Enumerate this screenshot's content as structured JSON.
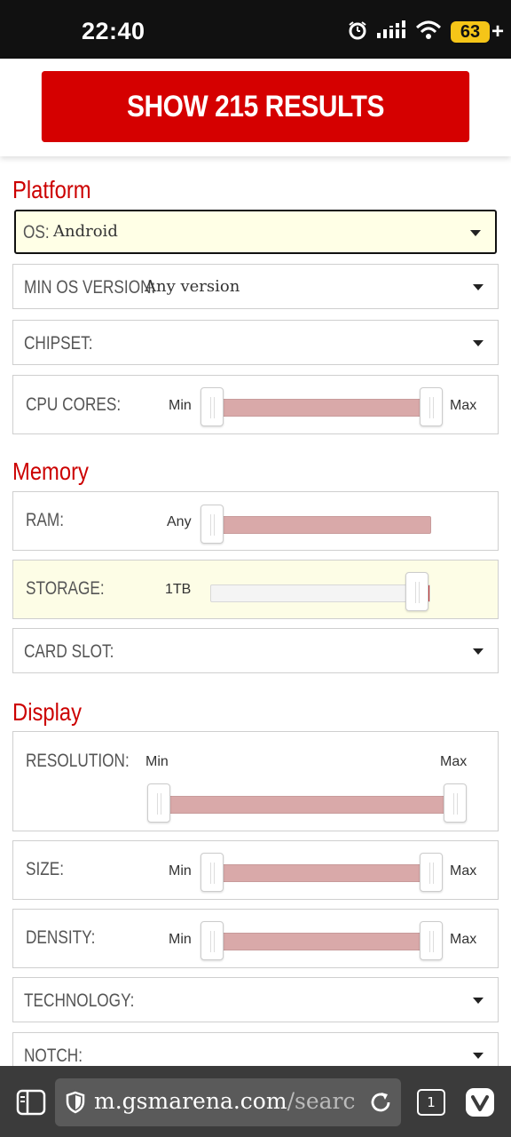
{
  "status_bar": {
    "time": "22:40",
    "battery_level": "63",
    "icons": [
      "alarm-icon",
      "signal-icon",
      "wifi-icon",
      "battery-icon"
    ]
  },
  "header": {
    "show_results_label": "SHOW 215 RESULTS"
  },
  "colors": {
    "accent": "#d50000",
    "section_title": "#cc0000",
    "slider_fill": "#d9a9a9"
  },
  "sections": {
    "platform": {
      "title": "Platform",
      "os": {
        "label": "OS:",
        "value": "Android"
      },
      "min_os_version": {
        "label": "MIN OS VERSION:",
        "value": "Any version"
      },
      "chipset": {
        "label": "CHIPSET:"
      },
      "cpu_cores": {
        "label": "CPU CORES:",
        "min": "Min",
        "max": "Max"
      }
    },
    "memory": {
      "title": "Memory",
      "ram": {
        "label": "RAM:",
        "value": "Any"
      },
      "storage": {
        "label": "STORAGE:",
        "value": "1TB"
      },
      "card_slot": {
        "label": "CARD SLOT:"
      }
    },
    "display": {
      "title": "Display",
      "resolution": {
        "label": "RESOLUTION:",
        "min": "Min",
        "max": "Max"
      },
      "size": {
        "label": "SIZE:",
        "min": "Min",
        "max": "Max"
      },
      "density": {
        "label": "DENSITY:",
        "min": "Min",
        "max": "Max"
      },
      "technology": {
        "label": "TECHNOLOGY:"
      },
      "notch": {
        "label": "NOTCH:"
      }
    }
  },
  "browser": {
    "url_main": "m.gsmarena.com",
    "url_rest": "/searc",
    "tab_count": "1",
    "icons": [
      "panels-icon",
      "shield-icon",
      "reload-icon",
      "tabs-icon",
      "vivaldi-icon"
    ]
  }
}
